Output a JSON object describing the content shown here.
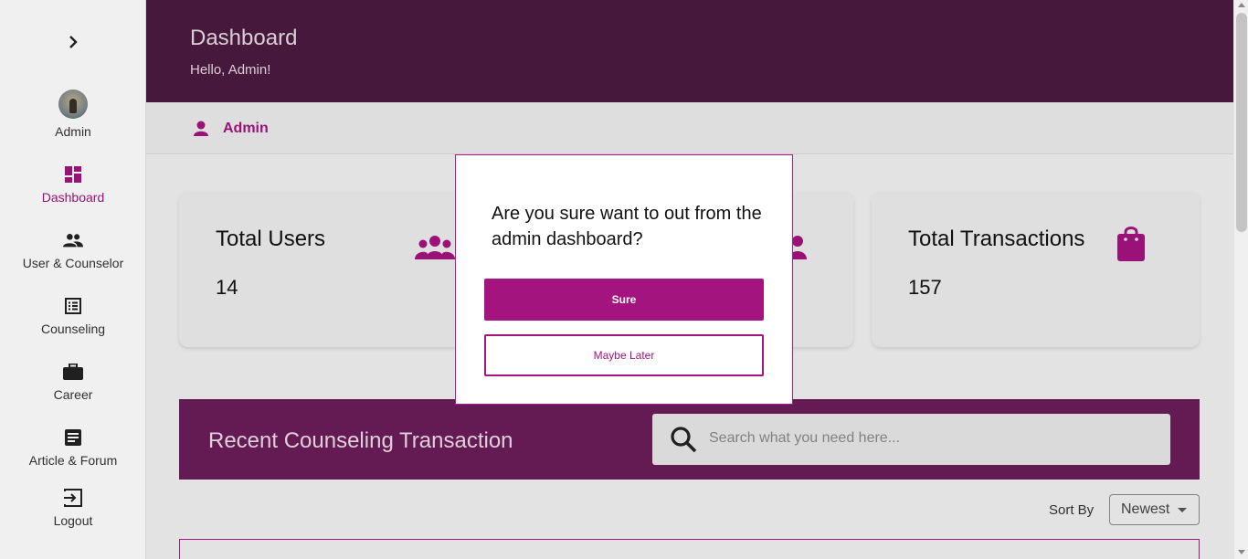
{
  "sidebar": {
    "user_name": "Admin",
    "items": [
      {
        "label": "Dashboard",
        "icon": "dashboard-icon",
        "active": true
      },
      {
        "label": "User & Counselor",
        "icon": "users-icon"
      },
      {
        "label": "Counseling",
        "icon": "list-icon"
      },
      {
        "label": "Career",
        "icon": "briefcase-icon"
      },
      {
        "label": "Article & Forum",
        "icon": "article-icon"
      },
      {
        "label": "Logout",
        "icon": "logout-icon"
      }
    ]
  },
  "header": {
    "title": "Dashboard",
    "subtitle": "Hello, Admin!"
  },
  "userbar": {
    "label": "Admin"
  },
  "stats": [
    {
      "title": "Total Users",
      "value": "14",
      "icon": "users-group-icon"
    },
    {
      "title": "Total Transactions",
      "value": "157",
      "icon": "shopping-bag-icon"
    }
  ],
  "recent": {
    "title": "Recent Counseling Transaction",
    "search_placeholder": "Search what you need here..."
  },
  "sort": {
    "label": "Sort By",
    "value": "Newest"
  },
  "modal": {
    "message": "Are you sure want to out from the admin dashboard?",
    "confirm_label": "Sure",
    "cancel_label": "Maybe Later"
  },
  "colors": {
    "accent": "#a4147f",
    "header": "#4b1a3f",
    "recent_banner": "#6b1c58"
  }
}
